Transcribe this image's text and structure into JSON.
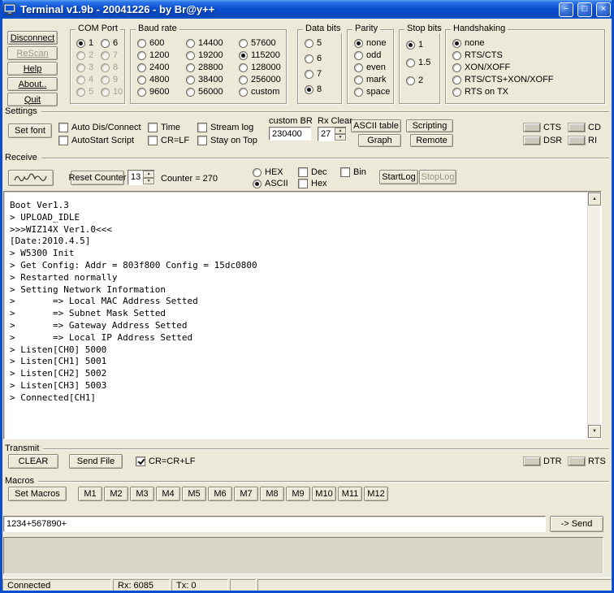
{
  "window": {
    "title": "Terminal v1.9b - 20041226 - by Br@y++"
  },
  "icons": {
    "minimize": "−",
    "maximize": "□",
    "close": "×",
    "spin_up": "▲",
    "spin_down": "▼",
    "scroll_up": "▲",
    "scroll_down": "▼"
  },
  "colors": {
    "titlebar_blue": "#0b4fd0",
    "window_bg": "#ece9d8",
    "terminal_bg": "#ffffff",
    "terminal_text": "#000000"
  },
  "actions": {
    "disconnect": "Disconnect",
    "rescan": "ReScan",
    "help": "Help",
    "about": "About..",
    "quit": "Quit"
  },
  "port_settings": {
    "com_port": {
      "label": "COM Port",
      "options": [
        "1",
        "2",
        "3",
        "4",
        "5",
        "6",
        "7",
        "8",
        "9",
        "10"
      ],
      "selected": "1"
    },
    "baud_rate": {
      "label": "Baud rate",
      "options": [
        "600",
        "1200",
        "2400",
        "4800",
        "9600",
        "14400",
        "19200",
        "28800",
        "38400",
        "56000",
        "57600",
        "115200",
        "128000",
        "256000",
        "custom"
      ],
      "selected": "115200"
    },
    "data_bits": {
      "label": "Data bits",
      "options": [
        "5",
        "6",
        "7",
        "8"
      ],
      "selected": "8"
    },
    "parity": {
      "label": "Parity",
      "options": [
        "none",
        "odd",
        "even",
        "mark",
        "space"
      ],
      "selected": "none"
    },
    "stop_bits": {
      "label": "Stop bits",
      "options": [
        "1",
        "1.5",
        "2"
      ],
      "selected": "1"
    },
    "handshaking": {
      "label": "Handshaking",
      "options": [
        "none",
        "RTS/CTS",
        "XON/XOFF",
        "RTS/CTS+XON/XOFF",
        "RTS on TX"
      ],
      "selected": "none"
    }
  },
  "settings": {
    "label": "Settings",
    "set_font": "Set font",
    "checks": {
      "auto_dis": "Auto Dis/Connect",
      "autostart": "AutoStart Script",
      "time": "Time",
      "cr_lf": "CR=LF",
      "stream_log": "Stream log",
      "stay_on_top": "Stay on Top"
    },
    "custom_br_label": "custom BR",
    "custom_br_value": "230400",
    "rx_clear_label": "Rx Clear",
    "rx_clear_value": "27",
    "ascii_table": "ASCII table",
    "scripting": "Scripting",
    "graph": "Graph",
    "remote": "Remote",
    "indicators": {
      "cts": "CTS",
      "cd": "CD",
      "dsr": "DSR",
      "ri": "RI"
    }
  },
  "receive": {
    "label": "Receive",
    "reset_counter": "Reset Counter",
    "counter_spin": "13",
    "counter_text": "Counter = 270",
    "hex_radio": "HEX",
    "ascii_radio": "ASCII",
    "dec_check": "Dec",
    "hex_check": "Hex",
    "bin_check": "Bin",
    "start_log": "StartLog",
    "stop_log": "StopLog",
    "terminal_lines": [
      "Boot Ver1.3",
      "> UPLOAD_IDLE",
      ">>>WIZ14X Ver1.0<<<",
      "[Date:2010.4.5]",
      "> W5300 Init",
      "> Get Config: Addr = 803f800 Config = 15dc0800",
      "> Restarted normally",
      "> Setting Network Information",
      ">\t=> Local MAC Address Setted",
      ">\t=> Subnet Mask Setted",
      ">\t=> Gateway Address Setted",
      ">\t=> Local IP Address Setted",
      "> Listen[CH0] 5000",
      "> Listen[CH1] 5001",
      "> Listen[CH2] 5002",
      "> Listen[CH3] 5003",
      "> Connected[CH1]"
    ]
  },
  "transmit": {
    "label": "Transmit",
    "clear": "CLEAR",
    "send_file": "Send File",
    "crlf_check": "CR=CR+LF",
    "indicators": {
      "dtr": "DTR",
      "rts": "RTS"
    }
  },
  "macros": {
    "label": "Macros",
    "set_macros": "Set Macros",
    "buttons": [
      "M1",
      "M2",
      "M3",
      "M4",
      "M5",
      "M6",
      "M7",
      "M8",
      "M9",
      "M10",
      "M11",
      "M12"
    ]
  },
  "send": {
    "input_value": "1234+567890+",
    "send_button": "-> Send"
  },
  "status_bar": {
    "connection": "Connected",
    "rx": "Rx: 6085",
    "tx": "Tx: 0"
  }
}
